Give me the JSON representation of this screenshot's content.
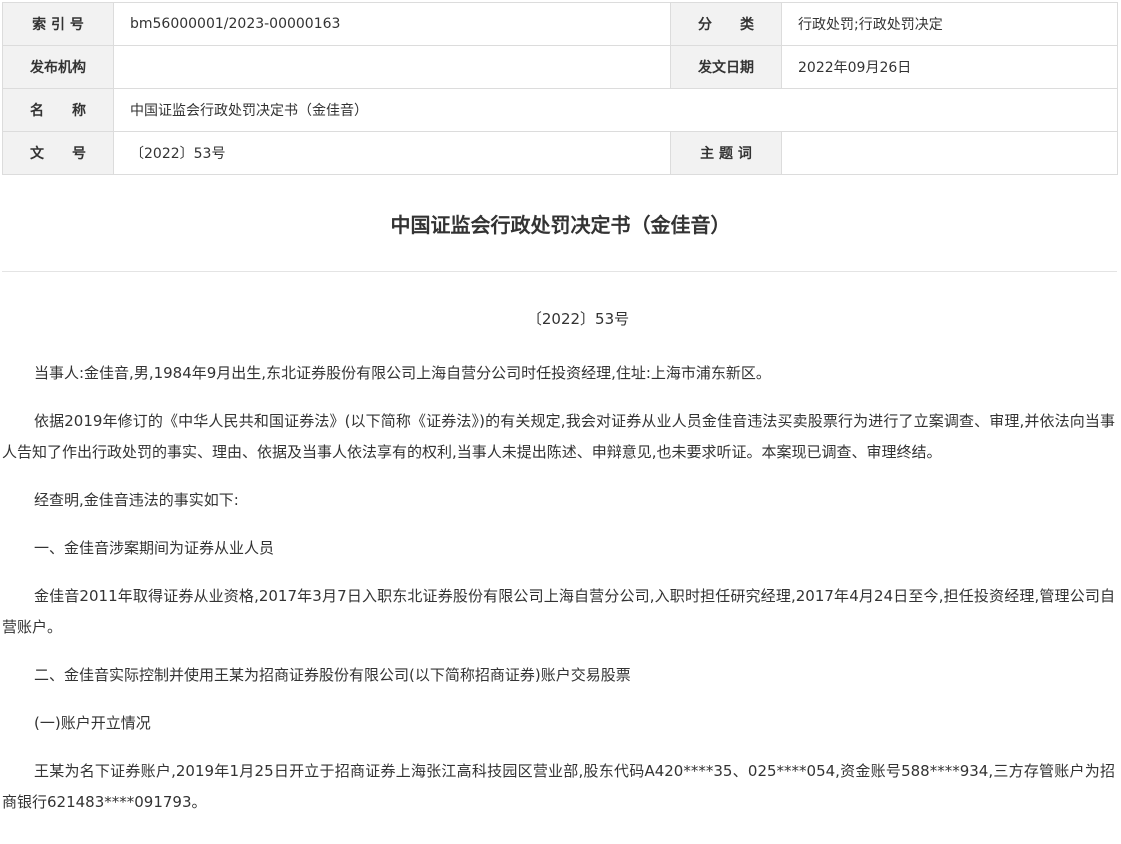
{
  "meta": {
    "index_label": "索 引 号",
    "index_value": "bm56000001/2023-00000163",
    "category_label": "分　　类",
    "category_value": "行政处罚;行政处罚决定",
    "issuer_label": "发布机构",
    "issuer_value": "",
    "date_label": "发文日期",
    "date_value": "2022年09月26日",
    "name_label": "名　　称",
    "name_value": "中国证监会行政处罚决定书（金佳音）",
    "docno_label": "文　　号",
    "docno_value": "〔2022〕53号",
    "keywords_label": "主 题 词",
    "keywords_value": ""
  },
  "document": {
    "title": "中国证监会行政处罚决定书（金佳音）",
    "doc_number": "〔2022〕53号",
    "paragraphs": [
      "当事人:金佳音,男,1984年9月出生,东北证券股份有限公司上海自营分公司时任投资经理,住址:上海市浦东新区。",
      "依据2019年修订的《中华人民共和国证券法》(以下简称《证券法》)的有关规定,我会对证券从业人员金佳音违法买卖股票行为进行了立案调查、审理,并依法向当事人告知了作出行政处罚的事实、理由、依据及当事人依法享有的权利,当事人未提出陈述、申辩意见,也未要求听证。本案现已调查、审理终结。",
      "经查明,金佳音违法的事实如下:",
      "一、金佳音涉案期间为证券从业人员",
      "金佳音2011年取得证券从业资格,2017年3月7日入职东北证券股份有限公司上海自营分公司,入职时担任研究经理,2017年4月24日至今,担任投资经理,管理公司自营账户。",
      "二、金佳音实际控制并使用王某为招商证券股份有限公司(以下简称招商证券)账户交易股票",
      "(一)账户开立情况",
      "王某为名下证券账户,2019年1月25日开立于招商证券上海张江高科技园区营业部,股东代码A420****35、025****054,资金账号588****934,三方存管账户为招商银行621483****091793。"
    ]
  }
}
